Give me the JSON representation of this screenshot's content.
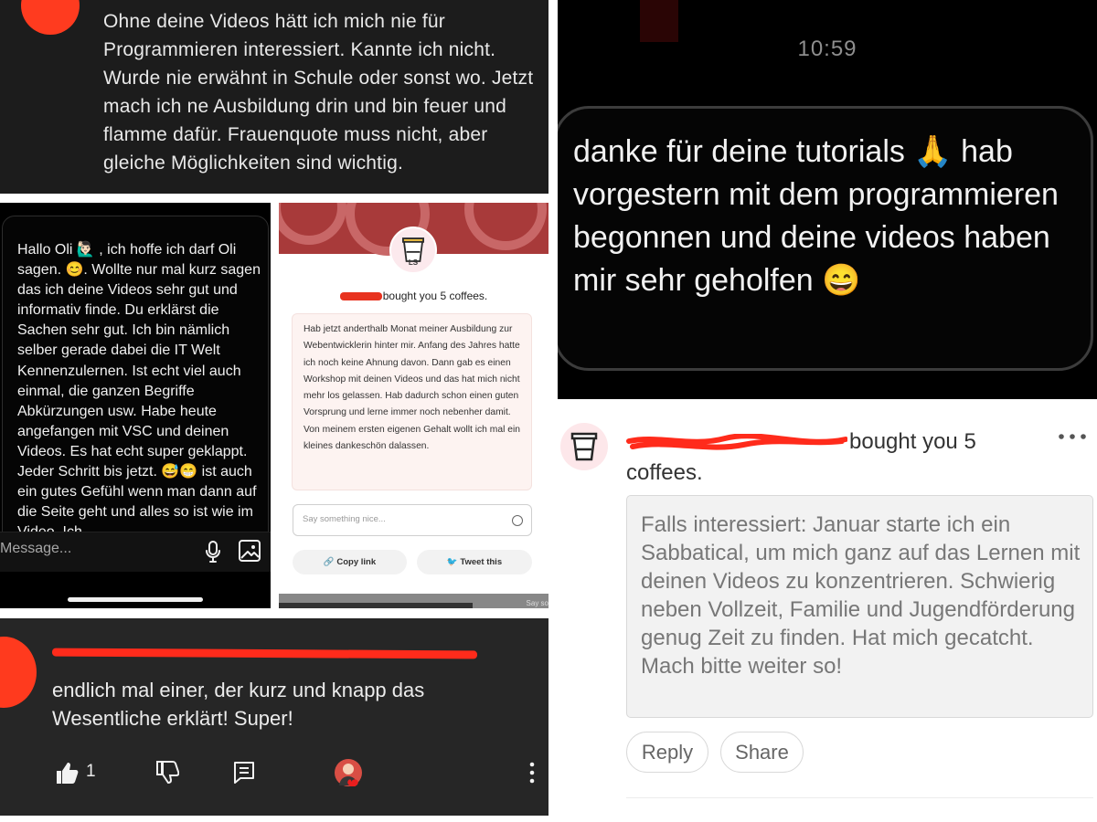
{
  "youtube_top": {
    "comment": "Ohne deine Videos hätt ich mich nie für Programmieren interessiert. Kannte ich nicht. Wurde nie erwähnt in Schule oder sonst wo. Jetzt mach ich ne Ausbildung drin und bin feuer und flamme dafür. Frauenquote muss nicht, aber gleiche Möglichkeiten sind wichtig."
  },
  "dm_dark": {
    "time": "10:59",
    "message": "danke für deine tutorials 🙏 hab vorgestern mit dem programmieren begonnen und deine videos haben mir sehr geholfen 😄"
  },
  "instagram_dm": {
    "message": "Hallo Oli 🙋🏻‍♂️ , ich hoffe ich darf Oli sagen. 😊. Wollte nur mal kurz sagen das ich deine Videos sehr gut und informativ finde. Du erklärst die Sachen sehr gut. Ich bin nämlich selber gerade dabei die IT Welt Kennenzulernen. Ist echt viel auch einmal, die ganzen Begriffe Abkürzungen usw. Habe heute angefangen mit VSC und deinen Videos. Es hat echt super geklappt. Jeder Schritt bis jetzt. 😅😁 ist auch ein gutes Gefühl wenn man dann auf die Seite geht und alles so ist wie im Video. Ich",
    "placeholder": "Message..."
  },
  "coffee_card": {
    "logo": "LS",
    "bought": "bought you 5 coffees.",
    "note": "Hab jetzt anderthalb Monat meiner Ausbildung zur Webentwicklerin hinter mir. Anfang des Jahres hatte ich noch keine Ahnung davon. Dann gab es einen Workshop mit deinen Videos und das hat mich nicht mehr los gelassen. Hab dadurch schon einen guten Vorsprung und lerne immer noch nebenher damit. Von meinem ersten eigenen Gehalt wollt ich mal ein kleines dankeschön dalassen.",
    "input_placeholder": "Say something nice...",
    "copy_link": "Copy link",
    "tweet": "Tweet this",
    "footer_hint": "Say so"
  },
  "youtube_bottom": {
    "comment": "endlich mal einer, der kurz und knapp das Wesentliche erklärt! Super!",
    "likes": "1"
  },
  "coffee_comment": {
    "bought": "bought you 5 coffees.",
    "message": "Falls interessiert: Januar starte ich ein Sabbatical, um mich ganz auf das Lernen mit deinen Videos zu konzentrieren. Schwierig neben Vollzeit, Familie und Jugendförderung genug Zeit zu finden. Hat mich gecatcht. Mach bitte weiter so!",
    "reply": "Reply",
    "share": "Share"
  },
  "colors": {
    "redaction": "#ff2b1b",
    "dark_panel": "#1c1c1c",
    "youtube_panel": "#262626",
    "coffee_pink": "#fdf3f1"
  },
  "icons": [
    "thumb-up-icon",
    "thumb-down-icon",
    "reply-icon",
    "microphone-icon",
    "image-icon",
    "link-icon",
    "twitter-icon",
    "more-icon",
    "coffee-cup-icon"
  ]
}
